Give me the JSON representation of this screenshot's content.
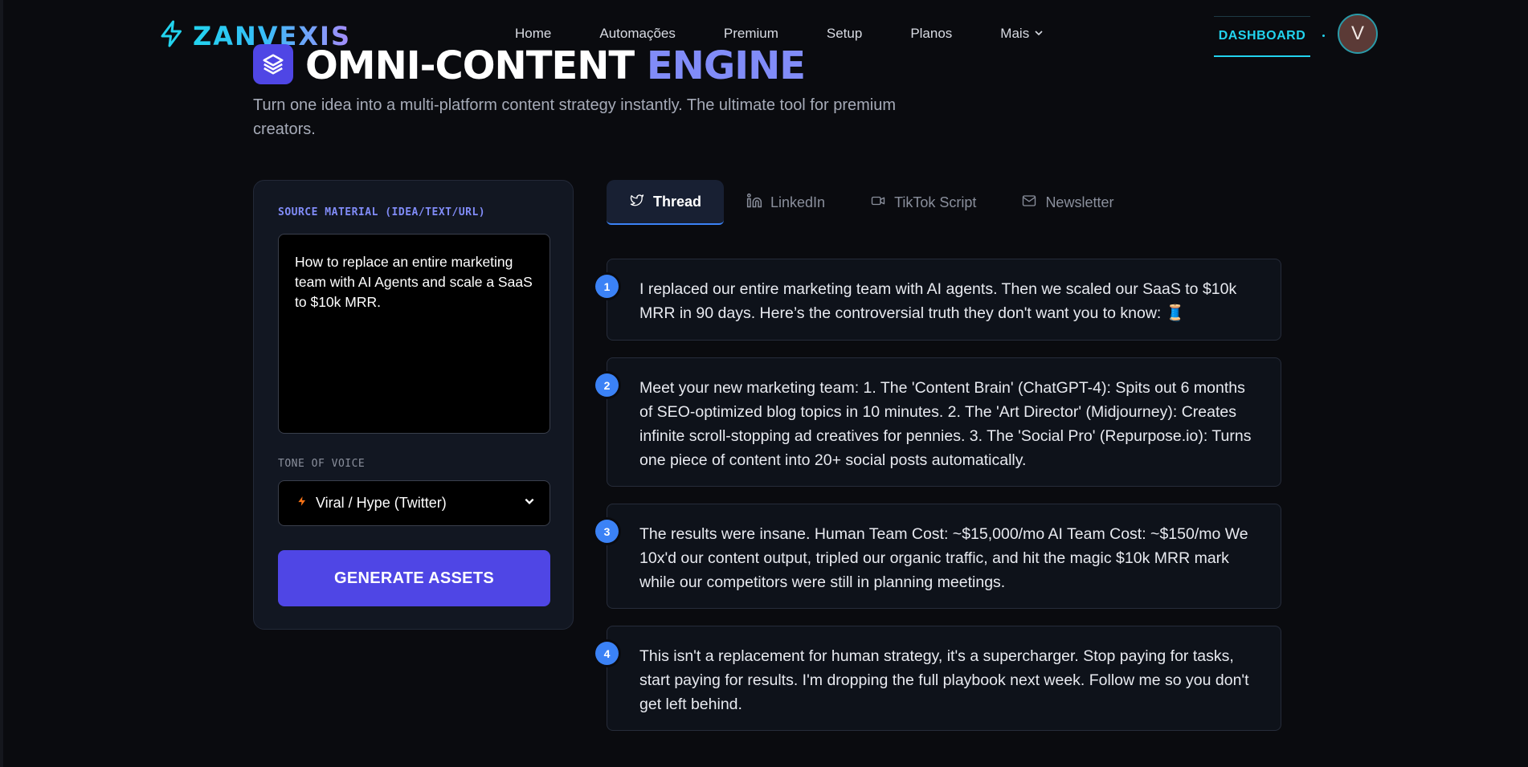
{
  "brand": {
    "name": "ZANVEXIS"
  },
  "nav": {
    "links": [
      "Home",
      "Automações",
      "Premium",
      "Setup",
      "Planos"
    ],
    "more_label": "Mais",
    "dashboard_label": "DASHBOARD",
    "avatar_initial": "V"
  },
  "hero": {
    "title_part1": "OMNI-CONTENT",
    "title_part2": "ENGINE",
    "subtitle": "Turn one idea into a multi-platform content strategy instantly. The ultimate tool for premium creators."
  },
  "form": {
    "source_label": "SOURCE MATERIAL (IDEA/TEXT/URL)",
    "source_value": "How to replace an entire marketing team with AI Agents and scale a SaaS to $10k MRR.",
    "tone_label": "TONE OF VOICE",
    "tone_value": "Viral / Hype (Twitter)",
    "generate_label": "GENERATE ASSETS"
  },
  "tabs": [
    {
      "label": "Thread",
      "icon": "twitter-icon",
      "active": true
    },
    {
      "label": "LinkedIn",
      "icon": "linkedin-icon",
      "active": false
    },
    {
      "label": "TikTok Script",
      "icon": "video-icon",
      "active": false
    },
    {
      "label": "Newsletter",
      "icon": "mail-icon",
      "active": false
    }
  ],
  "thread": [
    {
      "n": "1",
      "text": "I replaced our entire marketing team with AI agents. Then we scaled our SaaS to $10k MRR in 90 days. Here’s the controversial truth they don't want you to know: 🧵"
    },
    {
      "n": "2",
      "text": "Meet your new marketing team: 1. The 'Content Brain' (ChatGPT-4): Spits out 6 months of SEO-optimized blog topics in 10 minutes. 2. The 'Art Director' (Midjourney): Creates infinite scroll-stopping ad creatives for pennies. 3. The 'Social Pro' (Repurpose.io): Turns one piece of content into 20+ social posts automatically."
    },
    {
      "n": "3",
      "text": "The results were insane. Human Team Cost: ~$15,000/mo AI Team Cost: ~$150/mo We 10x'd our content output, tripled our organic traffic, and hit the magic $10k MRR mark while our competitors were still in planning meetings."
    },
    {
      "n": "4",
      "text": "This isn't a replacement for human strategy, it's a supercharger. Stop paying for tasks, start paying for results. I'm dropping the full playbook next week. Follow me so you don't get left behind."
    }
  ],
  "colors": {
    "accent": "#4f46e5",
    "cyan": "#22d3ee",
    "badge": "#3b82f6",
    "background": "#0a0b0f"
  }
}
